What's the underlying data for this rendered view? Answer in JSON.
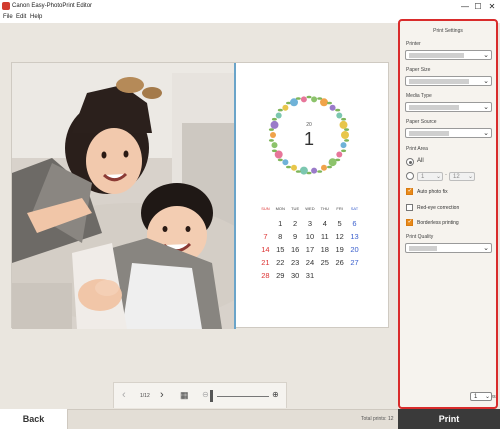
{
  "window": {
    "title": "Canon Easy-PhotoPrint Editor",
    "minimize": "—",
    "maximize": "☐",
    "close": "✕"
  },
  "menu": [
    "File",
    "Edit",
    "Help"
  ],
  "calendar": {
    "year": "20",
    "month": "1",
    "weekdays": [
      "SUN",
      "MON",
      "TUE",
      "WED",
      "THU",
      "FRI",
      "SAT"
    ],
    "weeks": [
      [
        "",
        "1",
        "2",
        "3",
        "4",
        "5",
        "6"
      ],
      [
        "7",
        "8",
        "9",
        "10",
        "11",
        "12",
        "13"
      ],
      [
        "14",
        "15",
        "16",
        "17",
        "18",
        "19",
        "20"
      ],
      [
        "21",
        "22",
        "23",
        "24",
        "25",
        "26",
        "27"
      ],
      [
        "28",
        "29",
        "30",
        "31",
        "",
        "",
        ""
      ]
    ]
  },
  "page_nav": {
    "prev_icon": "chevron-left-icon",
    "page_indicator": "1/12",
    "next_icon": "chevron-right-icon",
    "grid_icon": "grid-icon",
    "zoom_out_icon": "zoom-out-icon",
    "zoom_in_icon": "zoom-in-icon"
  },
  "bottom": {
    "back_label": "Back",
    "total_prints": "Total prints: 12",
    "print_label": "Print"
  },
  "settings": {
    "title": "Print Settings",
    "printer_label": "Printer",
    "paper_size_label": "Paper Size",
    "media_type_label": "Media Type",
    "paper_source_label": "Paper Source",
    "print_area_label": "Print Area",
    "all_label": "All",
    "range_from": "1",
    "range_to": "12",
    "range_sep": "-",
    "auto_photo_fix": "Auto photo fix",
    "red_eye": "Red-eye correction",
    "borderless": "Borderless printing",
    "print_quality_label": "Print Quality",
    "copies_label": "Copies",
    "copies_value": "1",
    "checks": {
      "auto_photo_fix": true,
      "red_eye": false,
      "borderless": true
    },
    "print_area_selected": "All"
  },
  "colors": {
    "highlight_border": "#d92b2b",
    "checkbox_on": "#e88a1a",
    "sunday": "#d33333",
    "saturday": "#3a5fcd"
  }
}
